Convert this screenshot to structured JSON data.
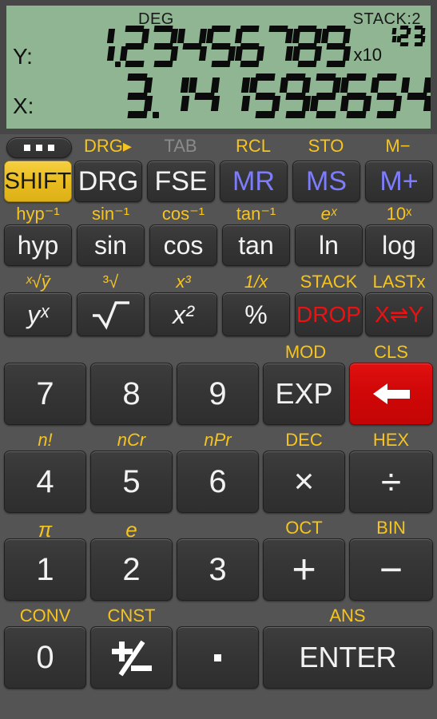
{
  "display": {
    "mode": "DEG",
    "stack_label": "STACK:2",
    "y_label": "Y:",
    "x_label": "X:",
    "y_value": "1.23456789",
    "y_exp_prefix": "x10",
    "y_exponent": "123",
    "x_value": "3.141592654",
    "lcd_color": "#8fb592",
    "segment_color": "#0b0b0b"
  },
  "colors": {
    "background": "#545454",
    "key_face": "#353535",
    "shift_yellow": "#e9bd22",
    "label_yellow": "#f6c41f",
    "memory_blue": "#7d7dfb",
    "stack_red": "#ee1111",
    "clear_red": "#cf0707",
    "dim_gray": "#8b8b8b"
  },
  "rows": {
    "row_shift": {
      "shifted_labels": [
        {
          "text": "",
          "state": "none"
        },
        {
          "text": "DRG▸",
          "state": "active"
        },
        {
          "text": "TAB",
          "state": "disabled"
        },
        {
          "text": "RCL",
          "state": "active"
        },
        {
          "text": "STO",
          "state": "active"
        },
        {
          "text": "M−",
          "state": "active"
        }
      ],
      "keys": [
        {
          "label": "•••",
          "name": "menu-button",
          "style": "dots"
        },
        {
          "label": "SHIFT",
          "name": "shift-button",
          "style": "shift"
        },
        {
          "label": "DRG",
          "name": "drg-button",
          "style": "normal"
        },
        {
          "label": "FSE",
          "name": "fse-button",
          "style": "normal"
        },
        {
          "label": "MR",
          "name": "mr-button",
          "style": "blue"
        },
        {
          "label": "MS",
          "name": "ms-button",
          "style": "blue"
        },
        {
          "label": "M+",
          "name": "m-plus-button",
          "style": "blue"
        }
      ]
    },
    "row_trig": {
      "shifted_labels": [
        "hyp⁻¹",
        "sin⁻¹",
        "cos⁻¹",
        "tan⁻¹",
        "eˣ",
        "10ˣ"
      ],
      "keys": [
        {
          "label": "hyp",
          "name": "hyp-button"
        },
        {
          "label": "sin",
          "name": "sin-button"
        },
        {
          "label": "cos",
          "name": "cos-button"
        },
        {
          "label": "tan",
          "name": "tan-button"
        },
        {
          "label": "ln",
          "name": "ln-button"
        },
        {
          "label": "log",
          "name": "log-button"
        }
      ]
    },
    "row_power": {
      "shifted_labels": [
        "ˣ√ȳ",
        "³√",
        "х³",
        "1/x",
        "STACK",
        "LASTx"
      ],
      "keys": [
        {
          "label": "yˣ",
          "name": "y-to-x-button",
          "style": "normal"
        },
        {
          "label": "√",
          "name": "sqrt-button",
          "style": "normal"
        },
        {
          "label": "x²",
          "name": "x-squared-button",
          "style": "normal"
        },
        {
          "label": "%",
          "name": "percent-button",
          "style": "normal"
        },
        {
          "label": "DROP",
          "name": "drop-button",
          "style": "red"
        },
        {
          "label": "X⇌Y",
          "name": "swap-xy-button",
          "style": "red"
        }
      ]
    },
    "row_789": {
      "shifted_labels": [
        "",
        "",
        "",
        "MOD",
        "CLS"
      ],
      "keys": [
        {
          "label": "7",
          "name": "digit-7-button",
          "style": "normal"
        },
        {
          "label": "8",
          "name": "digit-8-button",
          "style": "normal"
        },
        {
          "label": "9",
          "name": "digit-9-button",
          "style": "normal"
        },
        {
          "label": "EXP",
          "name": "exp-button",
          "style": "normal"
        },
        {
          "label": "←",
          "name": "backspace-button",
          "style": "redkey"
        }
      ]
    },
    "row_456": {
      "shifted_labels": [
        "n!",
        "nCr",
        "nPr",
        "DEC",
        "HEX"
      ],
      "keys": [
        {
          "label": "4",
          "name": "digit-4-button"
        },
        {
          "label": "5",
          "name": "digit-5-button"
        },
        {
          "label": "6",
          "name": "digit-6-button"
        },
        {
          "label": "×",
          "name": "multiply-button"
        },
        {
          "label": "÷",
          "name": "divide-button"
        }
      ]
    },
    "row_123": {
      "shifted_labels": [
        "π",
        "e",
        "",
        "OCT",
        "BIN"
      ],
      "keys": [
        {
          "label": "1",
          "name": "digit-1-button"
        },
        {
          "label": "2",
          "name": "digit-2-button"
        },
        {
          "label": "3",
          "name": "digit-3-button"
        },
        {
          "label": "+",
          "name": "plus-button"
        },
        {
          "label": "−",
          "name": "minus-button"
        }
      ]
    },
    "row_bottom": {
      "shifted_labels": [
        "CONV",
        "CNST",
        "",
        "ANS"
      ],
      "keys": [
        {
          "label": "0",
          "name": "digit-0-button"
        },
        {
          "label": "±",
          "name": "sign-toggle-button"
        },
        {
          "label": "·",
          "name": "decimal-point-button"
        },
        {
          "label": "ENTER",
          "name": "enter-button"
        }
      ]
    }
  }
}
